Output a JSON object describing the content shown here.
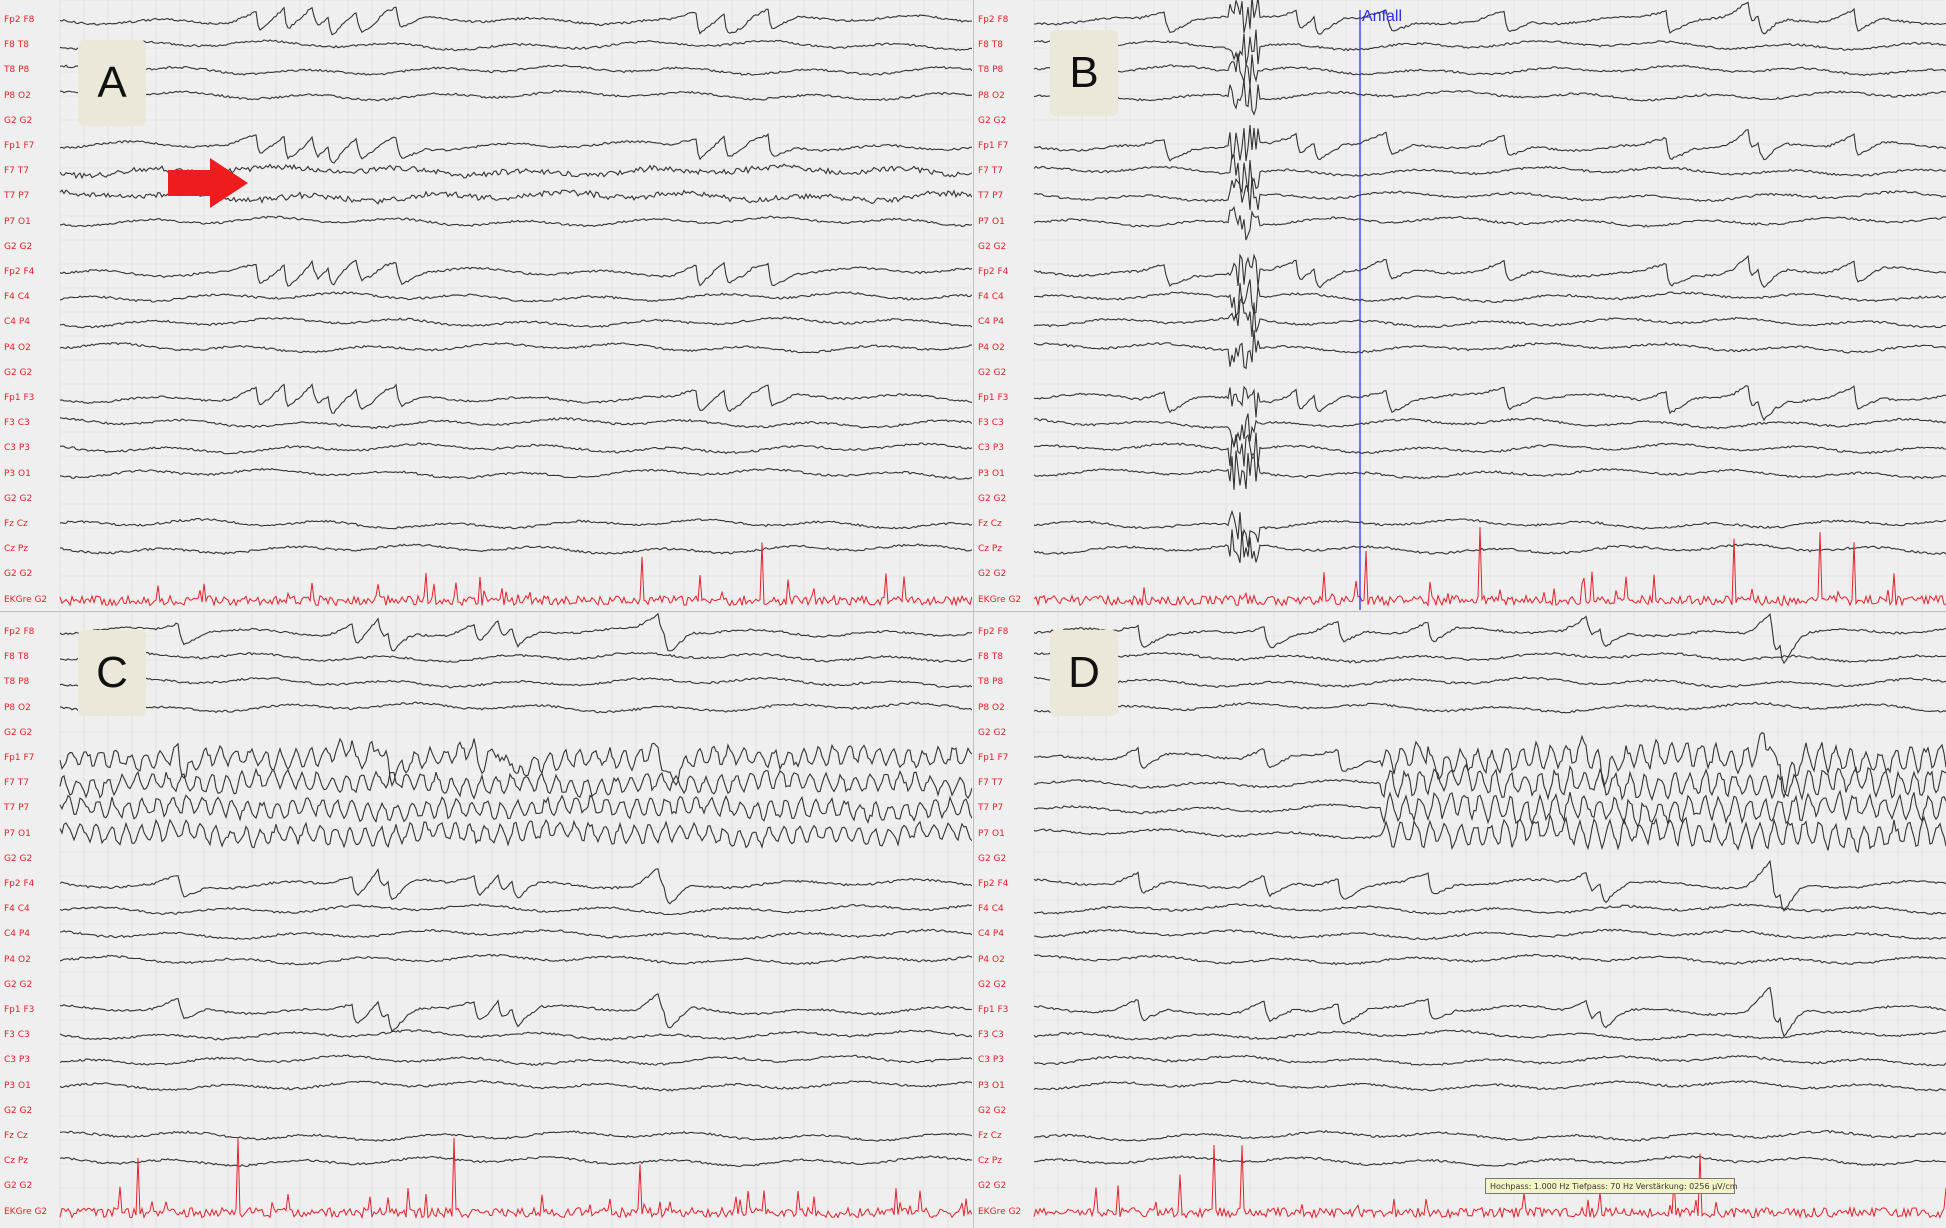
{
  "figure": {
    "colors": {
      "background": "#efefef",
      "grid": "#d9d9d9",
      "trace": "#333333",
      "label": "#e8202a",
      "ekg": "#e8202a",
      "marker": "#2b2bff",
      "arrow": "#ee1c1c",
      "letter_bg": "#ebe7d9"
    },
    "channels": [
      "Fp2 F8",
      "F8 T8",
      "T8 P8",
      "P8 O2",
      "G2 G2",
      "Fp1 F7",
      "F7 T7",
      "T7 P7",
      "P7 O1",
      "G2 G2",
      "Fp2 F4",
      "F4 C4",
      "C4 P4",
      "P4 O2",
      "G2 G2",
      "Fp1 F3",
      "F3 C3",
      "C3 P3",
      "P3 O1",
      "G2 G2",
      "Fz Cz",
      "Cz Pz",
      "G2 G2",
      "EKGre G2"
    ],
    "panels": [
      {
        "letter": "A",
        "arrow_icon": "right-arrow-icon",
        "marker": null,
        "status": null
      },
      {
        "letter": "B",
        "arrow_icon": null,
        "marker": {
          "text": "Anfall"
        },
        "status": null
      },
      {
        "letter": "C",
        "arrow_icon": null,
        "marker": null,
        "status": null
      },
      {
        "letter": "D",
        "arrow_icon": null,
        "marker": null,
        "status": {
          "text": "Hochpass: 1.000 Hz   Tiefpass: 70 Hz   Verstärkung: 0256 µV/cm"
        }
      }
    ]
  }
}
